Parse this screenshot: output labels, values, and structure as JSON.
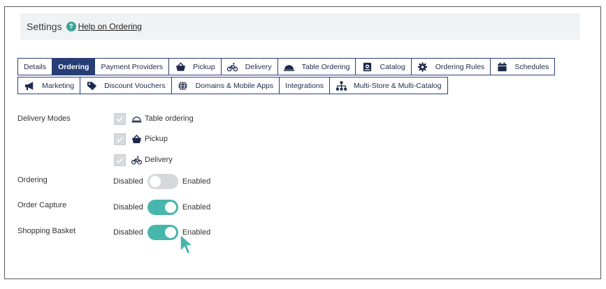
{
  "header": {
    "title": "Settings",
    "help_link": "Help on Ordering"
  },
  "tabs_row1": [
    {
      "label": "Details",
      "icon": ""
    },
    {
      "label": "Ordering",
      "icon": "",
      "active": true
    },
    {
      "label": "Payment Providers",
      "icon": ""
    },
    {
      "label": "Pickup",
      "icon": "basket-icon"
    },
    {
      "label": "Delivery",
      "icon": "bicycle-icon"
    },
    {
      "label": "Table Ordering",
      "icon": "cloche-icon"
    },
    {
      "label": "Catalog",
      "icon": "book-icon"
    },
    {
      "label": "Ordering Rules",
      "icon": "gear-icon"
    },
    {
      "label": "Schedules",
      "icon": "calendar-icon"
    }
  ],
  "tabs_row2": [
    {
      "label": "Marketing",
      "icon": "megaphone-icon"
    },
    {
      "label": "Discount Vouchers",
      "icon": "tag-icon"
    },
    {
      "label": "Domains & Mobile Apps",
      "icon": "globe-icon"
    },
    {
      "label": "Integrations",
      "icon": ""
    },
    {
      "label": "Multi-Store & Multi-Catalog",
      "icon": "sitemap-icon"
    }
  ],
  "delivery_modes": {
    "label": "Delivery Modes",
    "items": [
      {
        "label": "Table ordering",
        "icon": "cloche-icon",
        "checked": true
      },
      {
        "label": "Pickup",
        "icon": "basket-icon",
        "checked": true
      },
      {
        "label": "Delivery",
        "icon": "bicycle-icon",
        "checked": true
      }
    ]
  },
  "toggles": {
    "ordering": {
      "label": "Ordering",
      "off_text": "Disabled",
      "on_text": "Enabled",
      "enabled": false
    },
    "order_capture": {
      "label": "Order Capture",
      "off_text": "Disabled",
      "on_text": "Enabled",
      "enabled": true
    },
    "shopping_basket": {
      "label": "Shopping Basket",
      "off_text": "Disabled",
      "on_text": "Enabled",
      "enabled": true
    }
  },
  "colors": {
    "tab_border": "#2a3f73",
    "tab_active": "#263e75",
    "toggle_on": "#47b6ad",
    "toggle_off": "#d6d9dc",
    "help_icon": "#3aa39a"
  }
}
